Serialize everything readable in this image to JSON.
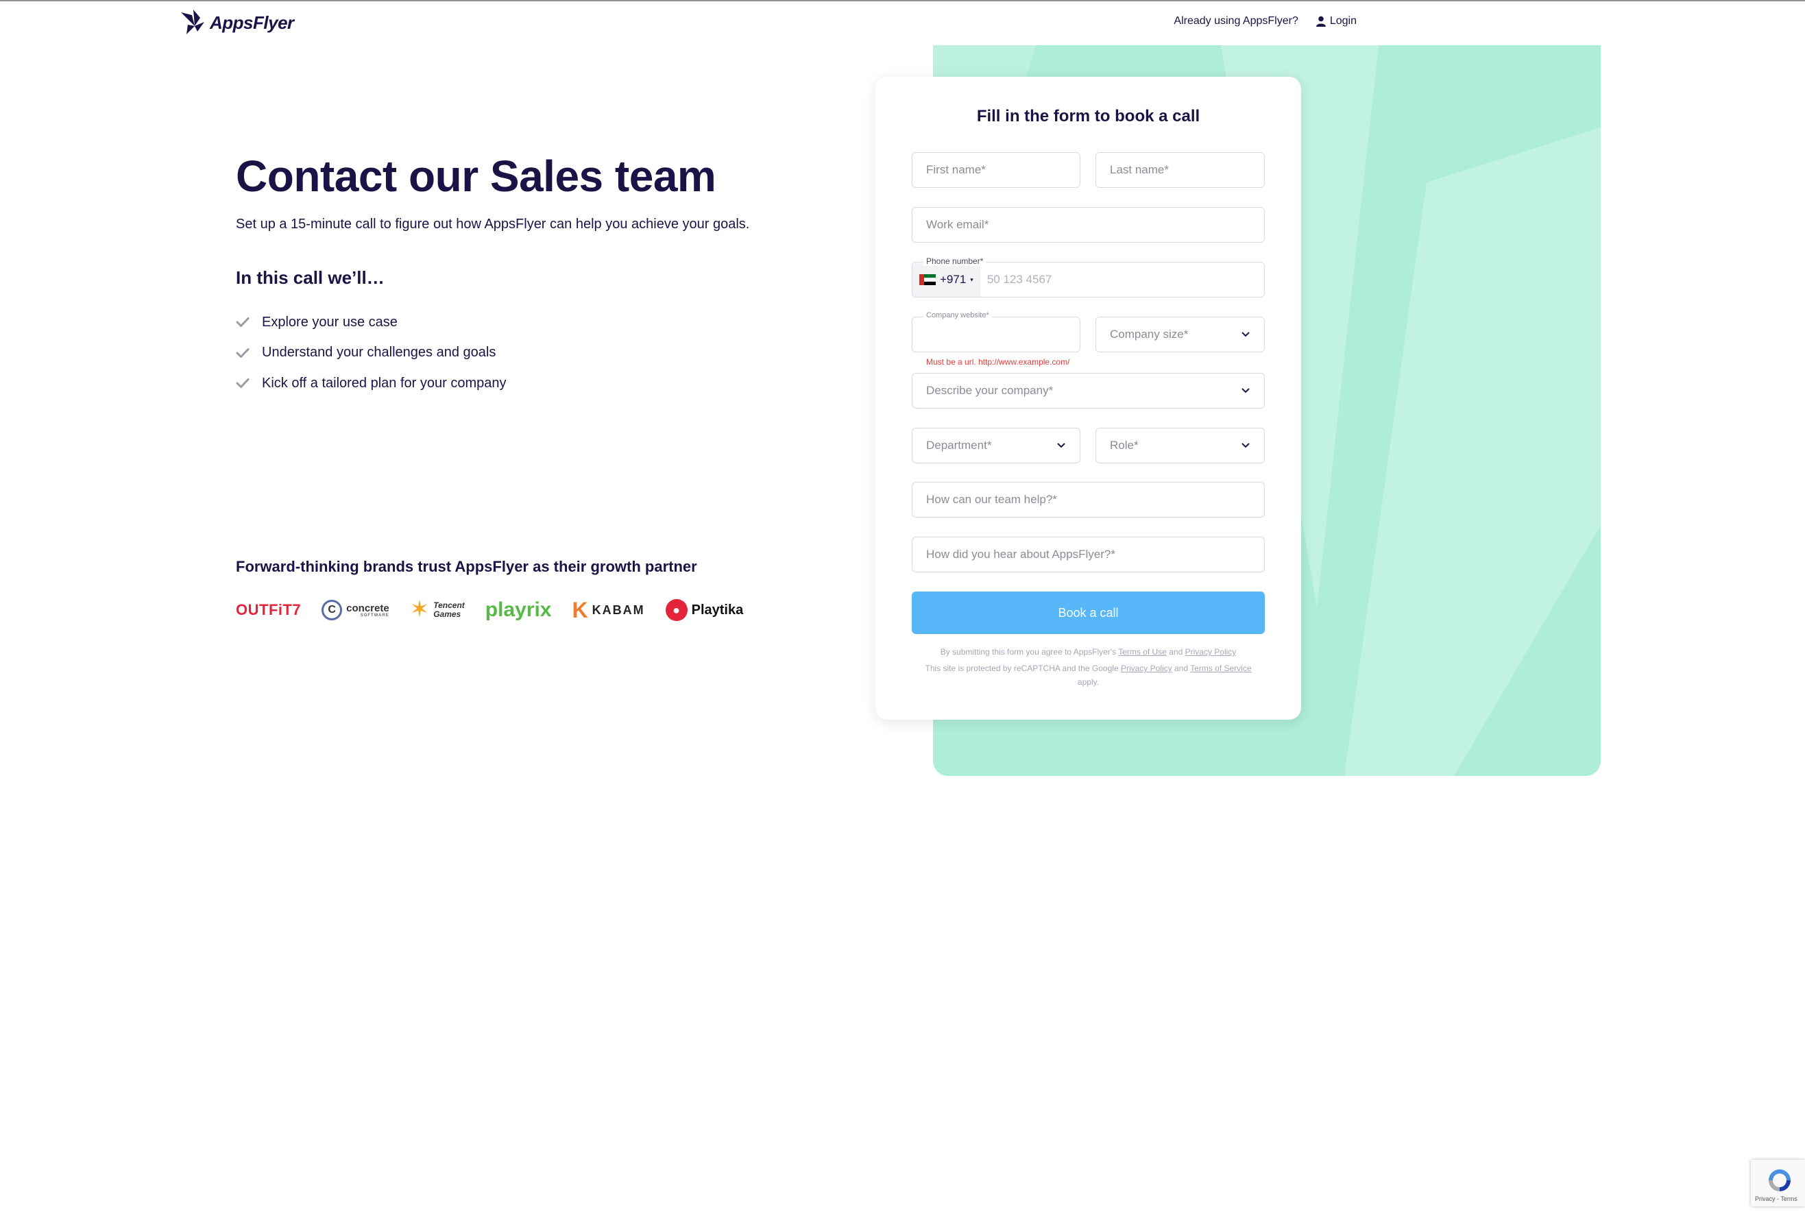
{
  "header": {
    "brand": "AppsFlyer",
    "already_using": "Already using AppsFlyer?",
    "login": "Login"
  },
  "hero": {
    "title": "Contact our Sales team",
    "subtitle": "Set up a 15-minute call to figure out how AppsFlyer can help you achieve your goals."
  },
  "call": {
    "title": "In this call we’ll…",
    "items": [
      {
        "label": "Explore your use case"
      },
      {
        "label": "Understand your challenges and goals"
      },
      {
        "label": "Kick off a tailored plan for your company"
      }
    ]
  },
  "brands": {
    "title": "Forward-thinking brands trust AppsFlyer as their growth partner",
    "logos": {
      "outfit7": "OUTFiT7",
      "concrete": "concrete",
      "concrete_sub": "SOFTWARE",
      "tencent_1": "Tencent",
      "tencent_2": "Games",
      "playrix": "playrix",
      "kabam_k": "K",
      "kabam": "KABAM",
      "playtika": "Playtika"
    }
  },
  "form": {
    "title": "Fill in the form to book a call",
    "first_name": "First name*",
    "last_name": "Last name*",
    "work_email": "Work email*",
    "phone_label": "Phone number*",
    "phone_code": "+971",
    "phone_placeholder": "50 123 4567",
    "company_website_label": "Company website*",
    "company_website_value": "",
    "company_size": "Company size*",
    "website_error": "Must be a url. http://www.example.com/",
    "describe_company": "Describe your company*",
    "department": "Department*",
    "role": "Role*",
    "team_help": "How can our team help?*",
    "hear_about": "How did you hear about AppsFlyer?*",
    "submit": "Book a call",
    "legal_1_pre": "By submitting this form you agree to AppsFlyer's",
    "terms_of_use": "Terms of Use",
    "and": "and",
    "privacy_policy": "Privacy Policy",
    "legal_2_pre": "This site is protected by reCAPTCHA and the Google",
    "privacy_policy_google": "Privacy Policy",
    "and_2": "and",
    "terms_of_service": "Terms of Service",
    "apply": "apply."
  },
  "recaptcha": {
    "text": "Privacy - Terms"
  },
  "colors": {
    "navy": "#1a1446",
    "mint": "#b7f0dc",
    "button": "#56b6f7",
    "error": "#e53b3b"
  }
}
